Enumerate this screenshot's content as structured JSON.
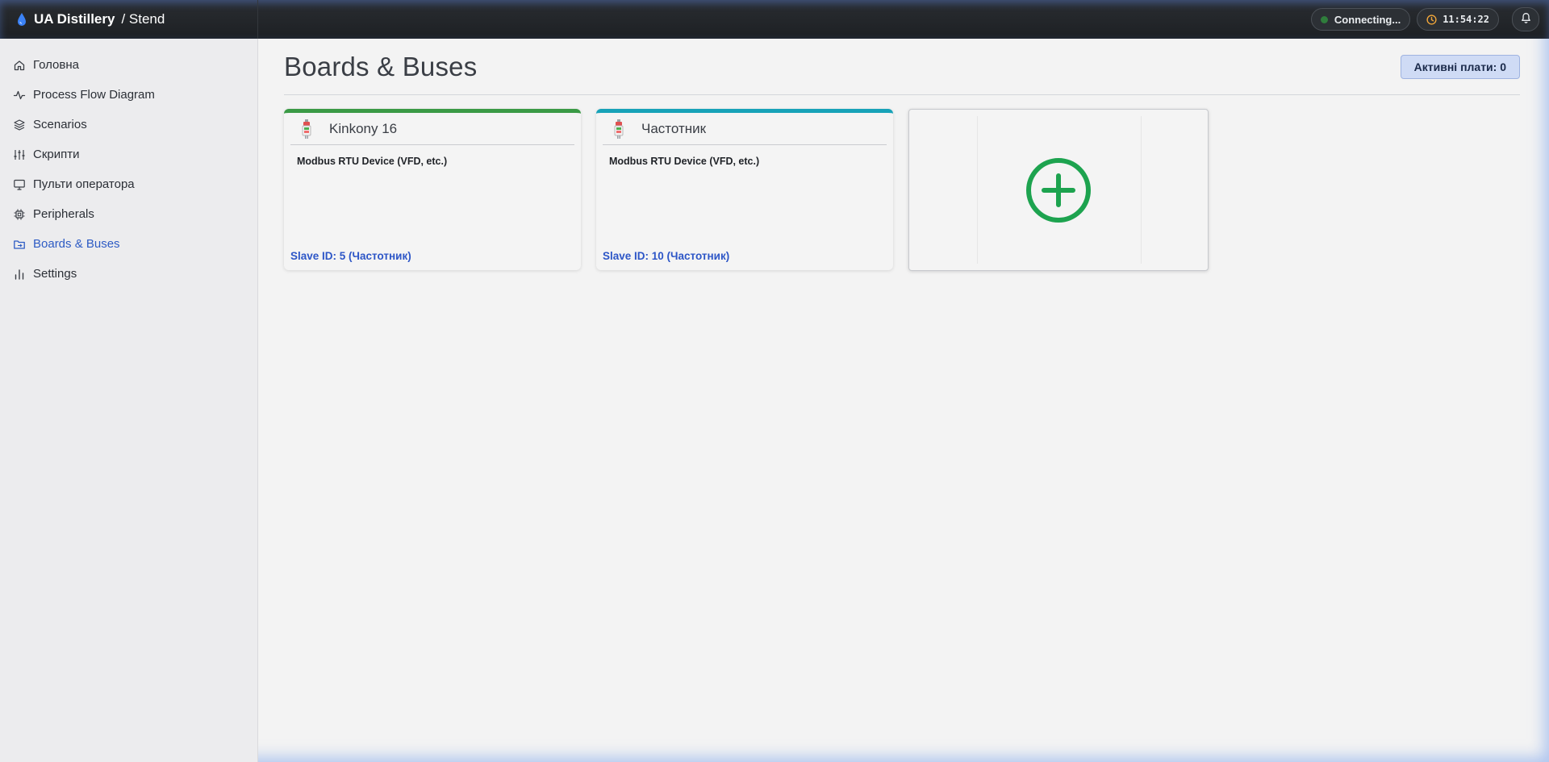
{
  "header": {
    "app_name": "UA Distillery",
    "context": "/ Stend",
    "connection_status": "Connecting...",
    "time": "11:54:22"
  },
  "sidebar": {
    "items": [
      {
        "label": "Головна",
        "icon": "home-icon"
      },
      {
        "label": "Process Flow Diagram",
        "icon": "activity-icon"
      },
      {
        "label": "Scenarios",
        "icon": "layers-icon"
      },
      {
        "label": "Скрипти",
        "icon": "sliders-icon"
      },
      {
        "label": "Пульти оператора",
        "icon": "monitor-icon"
      },
      {
        "label": "Peripherals",
        "icon": "chip-icon"
      },
      {
        "label": "Boards & Buses",
        "icon": "folder-icon",
        "active": true
      },
      {
        "label": "Settings",
        "icon": "bar-chart-icon"
      }
    ]
  },
  "main": {
    "title": "Boards & Buses",
    "active_boards_label": "Активні плати: 0",
    "cards": [
      {
        "name": "Kinkony 16",
        "type": "Modbus RTU Device (VFD, etc.)",
        "slave": "Slave ID: 5 (Частотник)",
        "accent": "#3a9a45"
      },
      {
        "name": "Частотник",
        "type": "Modbus RTU Device (VFD, etc.)",
        "slave": "Slave ID: 10 (Частотник)",
        "accent": "#17a2b8"
      }
    ]
  },
  "colors": {
    "accent": "#2d5bc4",
    "add_icon": "#1da34f",
    "topbar": "#1d2024"
  }
}
